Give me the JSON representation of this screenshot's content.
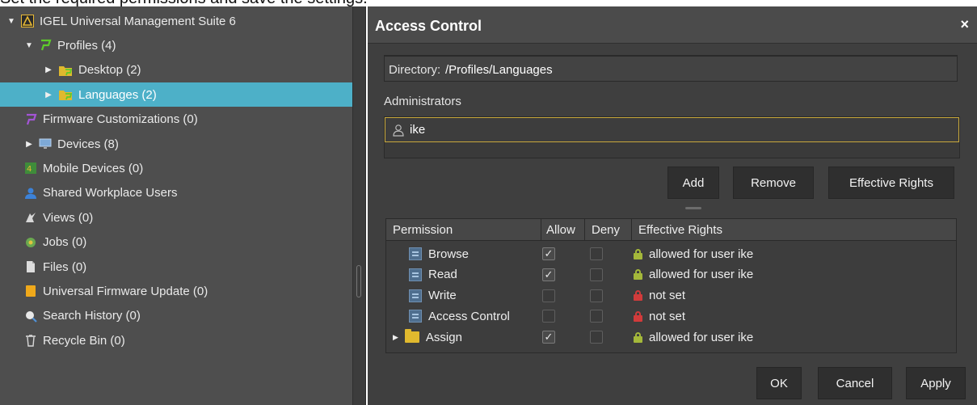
{
  "caption": "Set the required permissions and save the settings.",
  "tree": [
    {
      "label": "IGEL Universal Management Suite 6",
      "arrow": "▼",
      "icon": "ums-logo-icon",
      "indent": 8,
      "selected": false
    },
    {
      "label": "Profiles (4)",
      "arrow": "▼",
      "icon": "profiles-icon",
      "indent": 30,
      "selected": false
    },
    {
      "label": "Desktop (2)",
      "arrow": "▶",
      "icon": "folder-profile-icon",
      "indent": 54,
      "selected": false
    },
    {
      "label": "Languages (2)",
      "arrow": "▶",
      "icon": "folder-profile-icon",
      "indent": 54,
      "selected": true
    },
    {
      "label": "Firmware Customizations (0)",
      "arrow": "",
      "icon": "firmware-customization-icon",
      "indent": 30,
      "selected": false
    },
    {
      "label": "Devices (8)",
      "arrow": "▶",
      "icon": "devices-icon",
      "indent": 30,
      "selected": false
    },
    {
      "label": "Mobile Devices (0)",
      "arrow": "",
      "icon": "mobile-devices-icon",
      "indent": 30,
      "selected": false
    },
    {
      "label": "Shared Workplace Users",
      "arrow": "",
      "icon": "shared-users-icon",
      "indent": 30,
      "selected": false
    },
    {
      "label": "Views (0)",
      "arrow": "",
      "icon": "views-icon",
      "indent": 30,
      "selected": false
    },
    {
      "label": "Jobs (0)",
      "arrow": "",
      "icon": "jobs-icon",
      "indent": 30,
      "selected": false
    },
    {
      "label": "Files (0)",
      "arrow": "",
      "icon": "files-icon",
      "indent": 30,
      "selected": false
    },
    {
      "label": "Universal Firmware Update (0)",
      "arrow": "",
      "icon": "firmware-update-icon",
      "indent": 30,
      "selected": false
    },
    {
      "label": "Search History (0)",
      "arrow": "",
      "icon": "search-history-icon",
      "indent": 30,
      "selected": false
    },
    {
      "label": "Recycle Bin (0)",
      "arrow": "",
      "icon": "recycle-bin-icon",
      "indent": 30,
      "selected": false
    }
  ],
  "dialog": {
    "title": "Access Control",
    "close": "×",
    "directory_label": "Directory:",
    "directory_value": "/Profiles/Languages",
    "administrators_label": "Administrators",
    "administrators": [
      "ike"
    ],
    "buttons": {
      "add": "Add",
      "remove": "Remove",
      "effective_rights": "Effective Rights"
    },
    "table_headers": {
      "permission": "Permission",
      "allow": "Allow",
      "deny": "Deny",
      "effective": "Effective Rights"
    },
    "permissions": [
      {
        "name": "Browse",
        "icon": "permission-icon",
        "expandable": false,
        "allow": true,
        "deny": false,
        "effective": "allowed for user ike",
        "effective_status": "allowed"
      },
      {
        "name": "Read",
        "icon": "permission-icon",
        "expandable": false,
        "allow": true,
        "deny": false,
        "effective": "allowed for user ike",
        "effective_status": "allowed"
      },
      {
        "name": "Write",
        "icon": "permission-icon",
        "expandable": false,
        "allow": false,
        "deny": false,
        "effective": "not set",
        "effective_status": "not-set"
      },
      {
        "name": "Access Control",
        "icon": "permission-icon",
        "expandable": false,
        "allow": false,
        "deny": false,
        "effective": "not set",
        "effective_status": "not-set"
      },
      {
        "name": "Assign",
        "icon": "folder-icon",
        "expandable": true,
        "allow": true,
        "deny": false,
        "effective": "allowed for user ike",
        "effective_status": "allowed"
      }
    ],
    "footer": {
      "ok": "OK",
      "cancel": "Cancel",
      "apply": "Apply"
    }
  },
  "colors": {
    "selected_row": "#4db0c8",
    "allowed_lock": "#a4b83a",
    "not_set_lock": "#d23b3b",
    "admin_highlight": "#c9a93c"
  }
}
